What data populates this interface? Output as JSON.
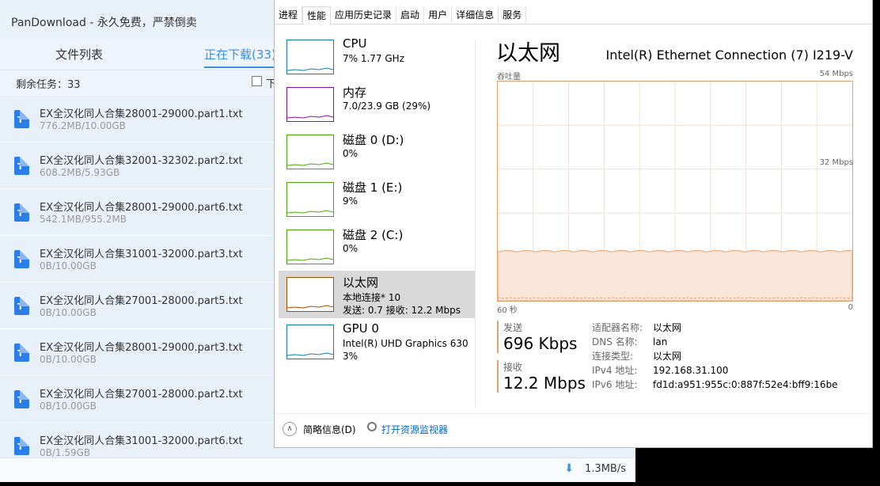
{
  "pandownload": {
    "title": "PanDownload - 永久免费，严禁倒卖",
    "tabs": [
      {
        "label": "文件列表"
      },
      {
        "label": "正在下载(33)"
      }
    ],
    "remaining": "剩余任务：33",
    "check_label": "下",
    "files": [
      {
        "name": "EX全汉化同人合集28001-29000.part1.txt",
        "size": "776.2MB/10.00GB"
      },
      {
        "name": "EX全汉化同人合集32001-32302.part2.txt",
        "size": "608.2MB/5.93GB"
      },
      {
        "name": "EX全汉化同人合集28001-29000.part6.txt",
        "size": "542.1MB/955.2MB"
      },
      {
        "name": "EX全汉化同人合集31001-32000.part3.txt",
        "size": "0B/10.00GB"
      },
      {
        "name": "EX全汉化同人合集27001-28000.part5.txt",
        "size": "0B/10.00GB"
      },
      {
        "name": "EX全汉化同人合集28001-29000.part3.txt",
        "size": "0B/10.00GB"
      },
      {
        "name": "EX全汉化同人合集27001-28000.part2.txt",
        "size": "0B/10.00GB"
      },
      {
        "name": "EX全汉化同人合集31001-32000.part6.txt",
        "size": "0B/1.59GB"
      }
    ],
    "file_icon_letter": "T",
    "speed": "1.3MB/s",
    "accent": "#3d8ee6"
  },
  "taskmgr": {
    "tabs": [
      {
        "label": "进程"
      },
      {
        "label": "性能"
      },
      {
        "label": "应用历史记录"
      },
      {
        "label": "启动"
      },
      {
        "label": "用户"
      },
      {
        "label": "详细信息"
      },
      {
        "label": "服务"
      }
    ],
    "devices": [
      {
        "name": "CPU",
        "sub": "7%  1.77 GHz",
        "sub2": "",
        "color": "#117dbb"
      },
      {
        "name": "内存",
        "sub": "7.0/23.9 GB (29%)",
        "sub2": "",
        "color": "#8b12ae"
      },
      {
        "name": "磁盘 0 (D:)",
        "sub": "0%",
        "sub2": "",
        "color": "#4da60c"
      },
      {
        "name": "磁盘 1 (E:)",
        "sub": "9%",
        "sub2": "",
        "color": "#4da60c"
      },
      {
        "name": "磁盘 2 (C:)",
        "sub": "0%",
        "sub2": "",
        "color": "#4da60c"
      },
      {
        "name": "以太网",
        "sub": "本地连接* 10",
        "sub2": "发送: 0.7 接收: 12.2 Mbps",
        "color": "#a74f01"
      },
      {
        "name": "GPU 0",
        "sub": "Intel(R) UHD Graphics 630",
        "sub2": "3%",
        "color": "#117dbb"
      }
    ],
    "selected_device": "以太网",
    "title": "以太网",
    "adapter_name": "Intel(R) Ethernet Connection (7) I219-V",
    "throughput_label": "吞吐量",
    "y_max": "54 Mbps",
    "y_mid": "32 Mbps",
    "x_left": "60 秒",
    "x_right": "0",
    "send_label": "发送",
    "send_value": "696 Kbps",
    "recv_label": "接收",
    "recv_value": "12.2 Mbps",
    "props": [
      {
        "k": "适配器名称:",
        "v": "以太网"
      },
      {
        "k": "DNS 名称:",
        "v": "lan"
      },
      {
        "k": "连接类型:",
        "v": "以太网"
      },
      {
        "k": "IPv4 地址:",
        "v": "192.168.31.100"
      },
      {
        "k": "IPv6 地址:",
        "v": "fd1d:a951:955c:0:887f:52e4:bff9:16be"
      }
    ],
    "brief_label": "简略信息(D)",
    "monitor_link": "打开资源监视器",
    "graph_color": "#e5a06c",
    "graph_fill": "#f9e6d8",
    "recv_level_fraction": 0.2259
  }
}
